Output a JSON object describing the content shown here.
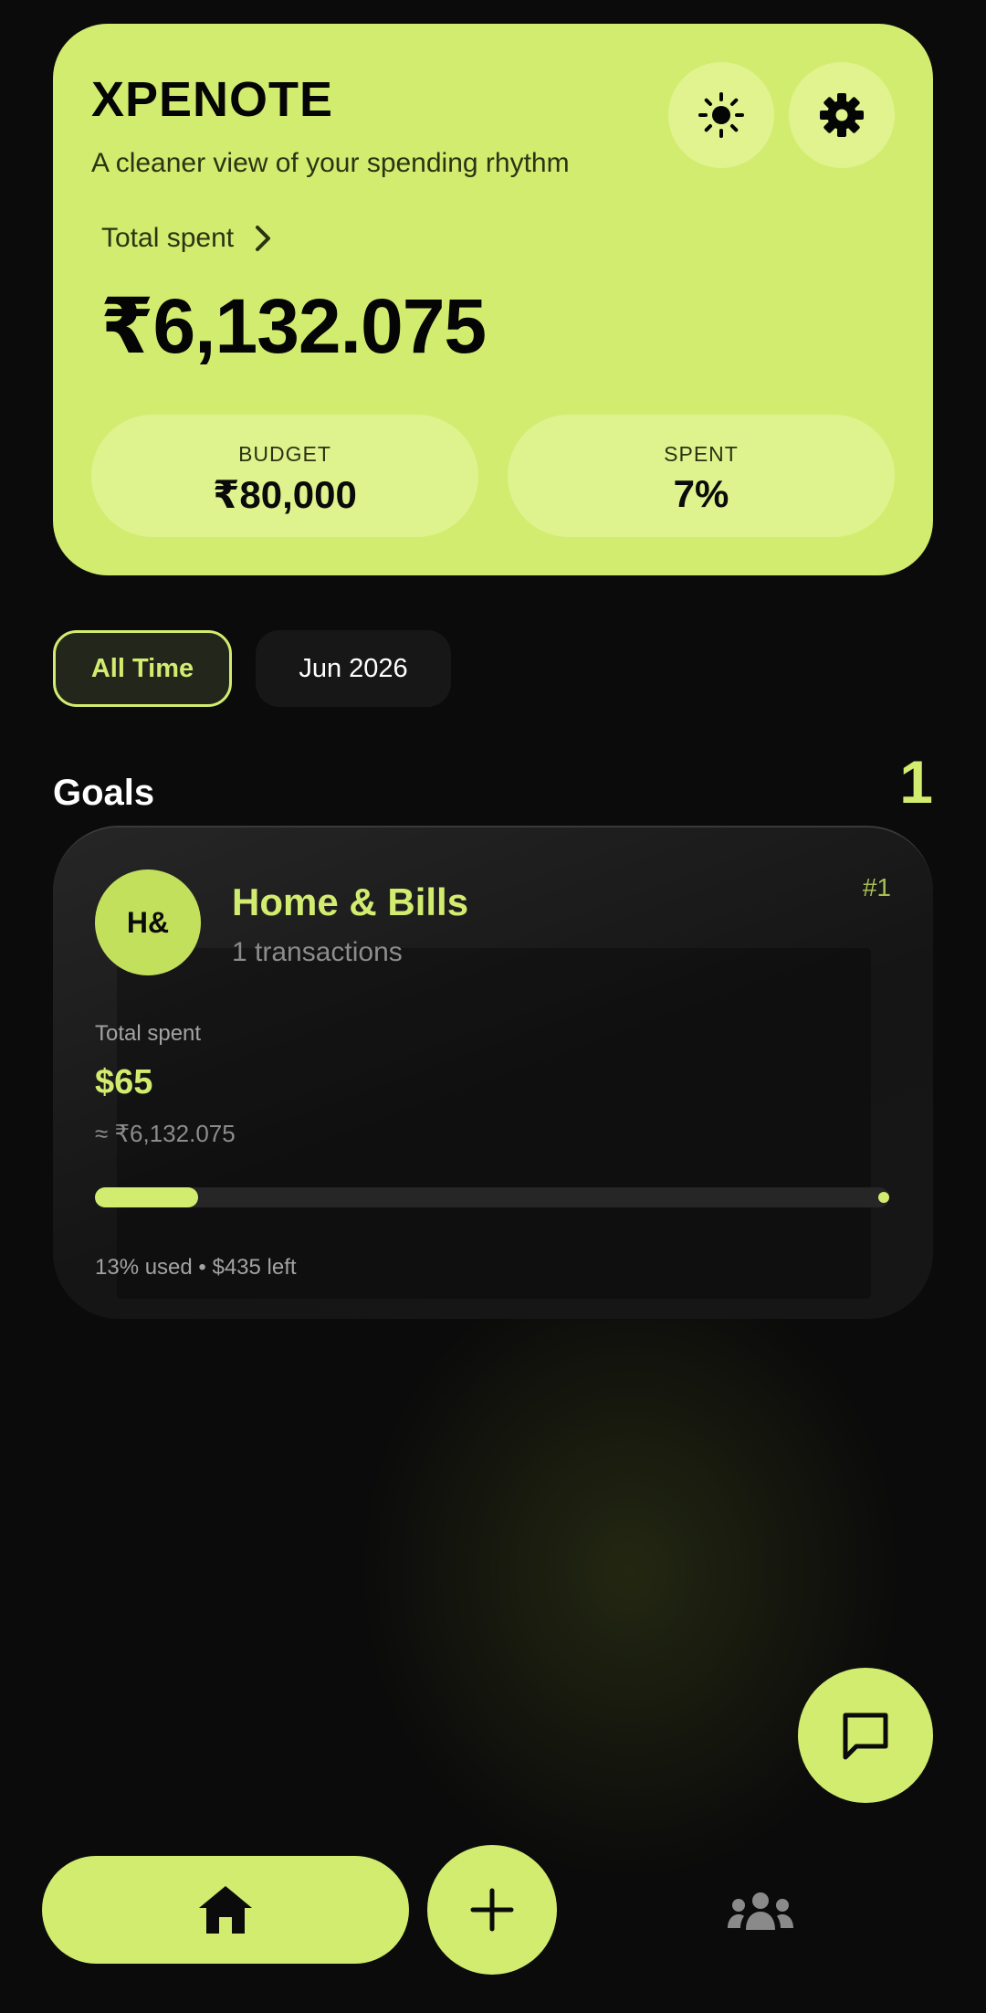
{
  "app": {
    "title": "XPENOTE",
    "subtitle": "A cleaner view of your spending rhythm"
  },
  "header": {
    "theme_icon": "sun-icon",
    "settings_icon": "gear-icon"
  },
  "summary": {
    "total_label": "Total spent",
    "total_amount": "₹6,132.075",
    "budget_label": "BUDGET",
    "budget_value": "₹80,000",
    "spent_label": "SPENT",
    "spent_value": "7%"
  },
  "filters": {
    "items": [
      {
        "label": "All Time",
        "active": true
      },
      {
        "label": "Jun 2026",
        "active": false
      }
    ]
  },
  "goals": {
    "title": "Goals",
    "count": "1",
    "items": [
      {
        "avatar": "H&",
        "name": "Home & Bills",
        "transactions": "1 transactions",
        "rank": "#1",
        "spent_label": "Total spent",
        "spent_value": "$65",
        "converted": "≈ ₹6,132.075",
        "progress_percent": 13,
        "summary": "13% used • $435 left"
      }
    ]
  },
  "colors": {
    "accent": "#d2ec70",
    "background": "#0b0b0b",
    "card": "#1b1b1b"
  },
  "fab": {
    "icon": "chat-icon"
  },
  "nav": {
    "home_icon": "home-icon",
    "add_icon": "plus-icon",
    "groups_icon": "people-icon"
  }
}
